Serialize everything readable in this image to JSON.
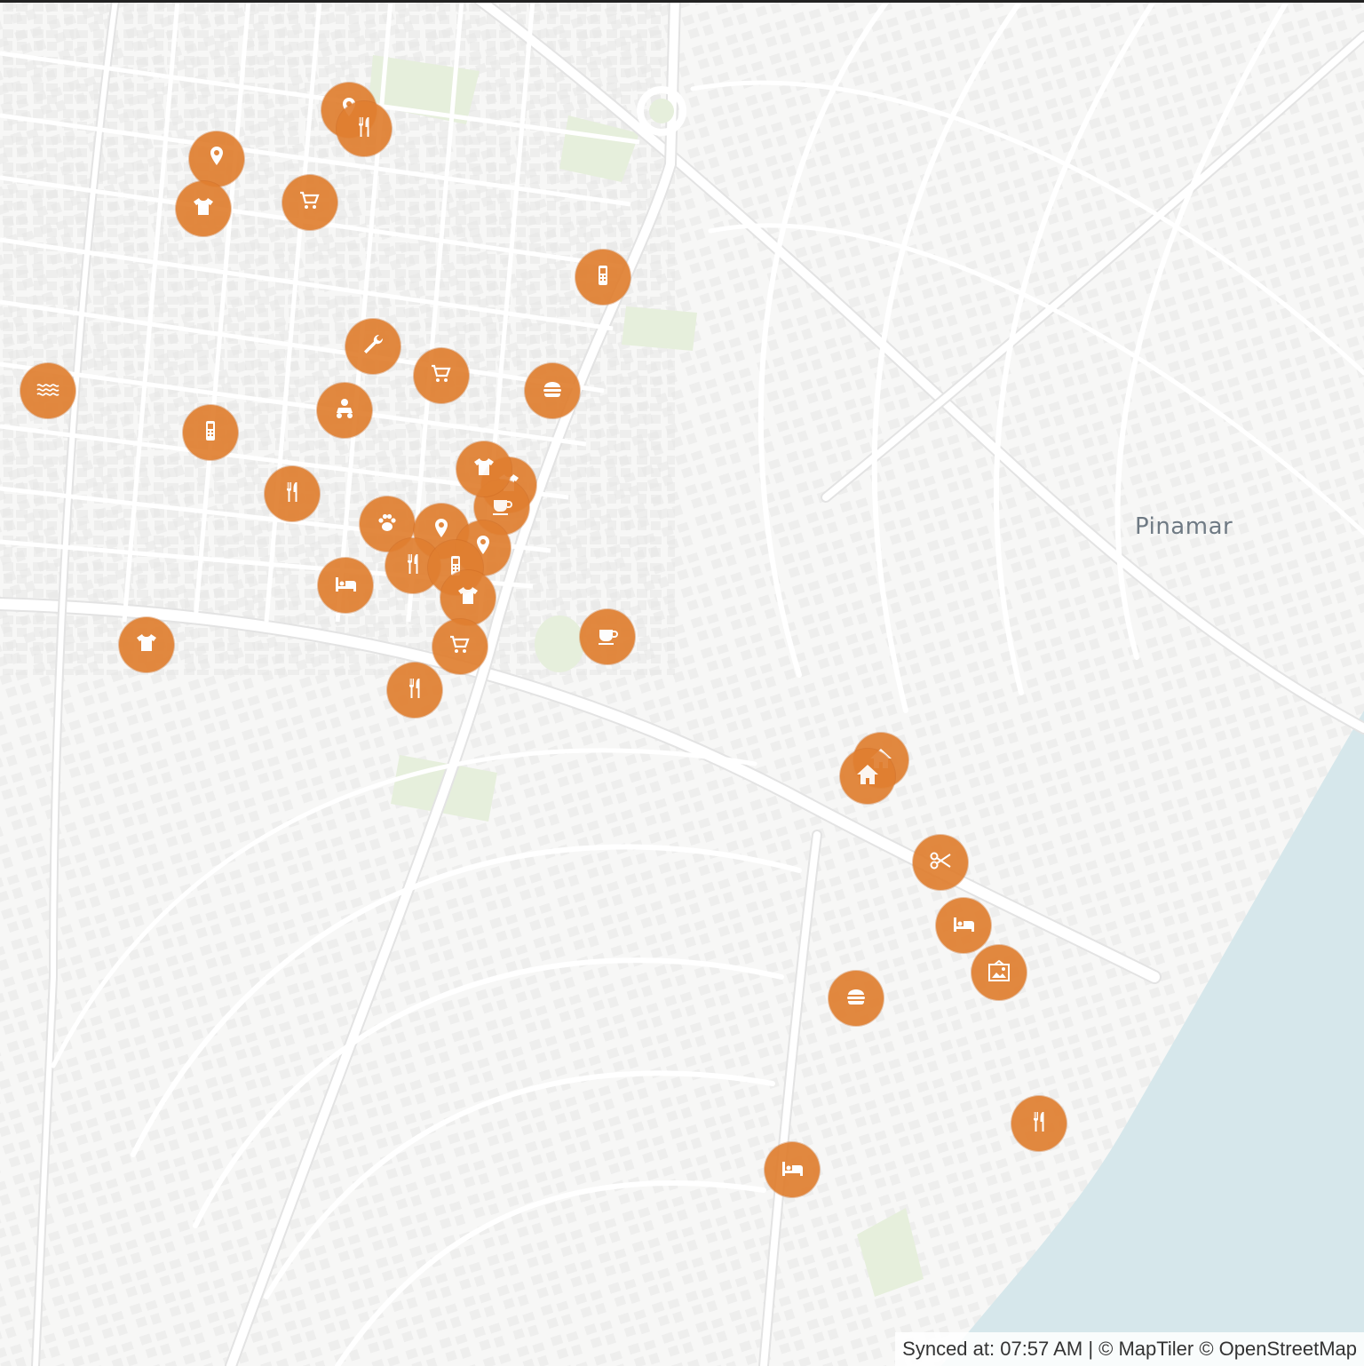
{
  "map": {
    "place_label": "Pinamar",
    "marker_color": "#e07f30",
    "water_color": "#d6e7eb",
    "markers": [
      {
        "icon": "pin-icon"
      },
      {
        "icon": "fork-knife-icon"
      },
      {
        "icon": "pin-icon"
      },
      {
        "icon": "cart-icon"
      },
      {
        "icon": "shirt-icon"
      },
      {
        "icon": "phone-icon"
      },
      {
        "icon": "wrench-icon"
      },
      {
        "icon": "cart-icon"
      },
      {
        "icon": "burger-icon"
      },
      {
        "icon": "waves-icon"
      },
      {
        "icon": "kart-icon"
      },
      {
        "icon": "phone-icon"
      },
      {
        "icon": "fork-knife-icon"
      },
      {
        "icon": "shirt-icon"
      },
      {
        "icon": "coffee-icon"
      },
      {
        "icon": "paw-icon"
      },
      {
        "icon": "pin-icon"
      },
      {
        "icon": "pin-icon"
      },
      {
        "icon": "fork-knife-icon"
      },
      {
        "icon": "phone-icon"
      },
      {
        "icon": "bed-icon"
      },
      {
        "icon": "shirt-icon"
      },
      {
        "icon": "shirt-icon"
      },
      {
        "icon": "cart-icon"
      },
      {
        "icon": "fork-knife-icon"
      },
      {
        "icon": "coffee-icon"
      },
      {
        "icon": "home-icon"
      },
      {
        "icon": "home-icon"
      },
      {
        "icon": "scissors-icon"
      },
      {
        "icon": "bed-icon"
      },
      {
        "icon": "gallery-icon"
      },
      {
        "icon": "burger-icon"
      },
      {
        "icon": "fork-knife-icon"
      },
      {
        "icon": "bed-icon"
      },
      {
        "icon": "shirt-icon"
      }
    ]
  },
  "attribution": {
    "synced_label": "Synced at: 07:57 AM",
    "separator": "|",
    "maptiler": "© MapTiler",
    "osm": "© OpenStreetMap"
  }
}
